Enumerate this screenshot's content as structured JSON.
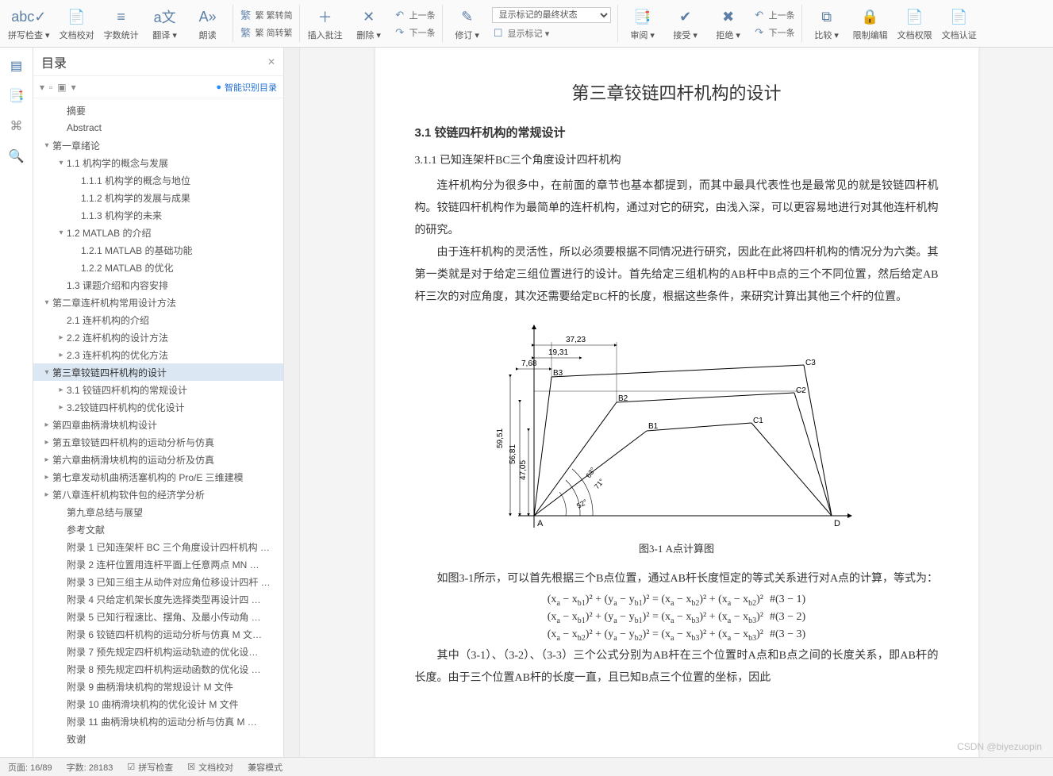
{
  "ribbon": {
    "big": [
      {
        "id": "spellcheck",
        "icon": "abc✓",
        "label": "拼写检查 ▾"
      },
      {
        "id": "docproof",
        "icon": "📄",
        "label": "文档校对"
      },
      {
        "id": "wordcount",
        "icon": "≡",
        "label": "字数统计"
      },
      {
        "id": "translate",
        "icon": "a文",
        "label": "翻译 ▾"
      },
      {
        "id": "readaloud",
        "icon": "A»",
        "label": "朗读"
      }
    ],
    "convert": {
      "top": "繁 繁转简",
      "bottom": "繁 简转繁",
      "icon": "繁"
    },
    "big2": [
      {
        "id": "insertcomment",
        "icon": "＋",
        "label": "插入批注"
      },
      {
        "id": "deletecomment",
        "icon": "✕",
        "label": "删除 ▾"
      }
    ],
    "nav": {
      "prev": "上一条",
      "next": "下一条",
      "prev_icon": "↶",
      "next_icon": "↷"
    },
    "big3": [
      {
        "id": "revise",
        "icon": "✎",
        "label": "修订 ▾"
      }
    ],
    "show": {
      "select_label": "显示标记的最终状态",
      "show_mark_label": "显示标记 ▾",
      "show_mark_icon": "☐"
    },
    "big4": [
      {
        "id": "reviewpane",
        "icon": "📑",
        "label": "审阅 ▾"
      },
      {
        "id": "accept",
        "icon": "✔",
        "label": "接受 ▾"
      },
      {
        "id": "reject",
        "icon": "✖",
        "label": "拒绝 ▾"
      }
    ],
    "nav2": {
      "prev": "上一条",
      "next": "下一条",
      "prev_icon": "↶",
      "next_icon": "↷"
    },
    "big5": [
      {
        "id": "compare",
        "icon": "⧉",
        "label": "比较 ▾"
      },
      {
        "id": "restrict",
        "icon": "🔒",
        "label": "限制编辑"
      },
      {
        "id": "docperm",
        "icon": "📄",
        "label": "文档权限"
      },
      {
        "id": "doccert",
        "icon": "📄",
        "label": "文档认证"
      }
    ]
  },
  "sidetabs": [
    {
      "id": "outline",
      "icon": "▤",
      "active": true
    },
    {
      "id": "nav",
      "icon": "📑",
      "active": false
    },
    {
      "id": "bookmark",
      "icon": "⌘",
      "active": false
    },
    {
      "id": "search",
      "icon": "🔍",
      "active": false
    }
  ],
  "outline": {
    "title": "目录",
    "close": "✕",
    "tools_left": [
      "▾",
      "▫",
      "▣",
      "▾"
    ],
    "smart_label": "智能识别目录",
    "smart_icon": "●",
    "items": [
      {
        "d": 1,
        "t": "",
        "lbl": "摘要"
      },
      {
        "d": 1,
        "t": "",
        "lbl": "Abstract"
      },
      {
        "d": 0,
        "t": "▾",
        "lbl": "第一章绪论"
      },
      {
        "d": 1,
        "t": "▾",
        "lbl": "1.1 机构学的概念与发展"
      },
      {
        "d": 2,
        "t": "",
        "lbl": "1.1.1 机构学的概念与地位"
      },
      {
        "d": 2,
        "t": "",
        "lbl": "1.1.2 机构学的发展与成果"
      },
      {
        "d": 2,
        "t": "",
        "lbl": "1.1.3 机构学的未来"
      },
      {
        "d": 1,
        "t": "▾",
        "lbl": "1.2 MATLAB 的介绍"
      },
      {
        "d": 2,
        "t": "",
        "lbl": "1.2.1 MATLAB 的基础功能"
      },
      {
        "d": 2,
        "t": "",
        "lbl": "1.2.2 MATLAB 的优化"
      },
      {
        "d": 1,
        "t": "",
        "lbl": "1.3 课题介绍和内容安排"
      },
      {
        "d": 0,
        "t": "▾",
        "lbl": "第二章连杆机构常用设计方法"
      },
      {
        "d": 1,
        "t": "",
        "lbl": "2.1 连杆机构的介绍"
      },
      {
        "d": 1,
        "t": "▸",
        "lbl": "2.2 连杆机构的设计方法"
      },
      {
        "d": 1,
        "t": "▸",
        "lbl": "2.3 连杆机构的优化方法"
      },
      {
        "d": 0,
        "t": "▾",
        "lbl": "第三章铰链四杆机构的设计",
        "sel": true
      },
      {
        "d": 1,
        "t": "▸",
        "lbl": "3.1 铰链四杆机构的常规设计"
      },
      {
        "d": 1,
        "t": "▸",
        "lbl": "3.2铰链四杆机构的优化设计"
      },
      {
        "d": 0,
        "t": "▸",
        "lbl": "第四章曲柄滑块机构设计"
      },
      {
        "d": 0,
        "t": "▸",
        "lbl": "第五章铰链四杆机构的运动分析与仿真"
      },
      {
        "d": 0,
        "t": "▸",
        "lbl": "第六章曲柄滑块机构的运动分析及仿真"
      },
      {
        "d": 0,
        "t": "▸",
        "lbl": "第七章发动机曲柄活塞机构的 Pro/E 三维建模"
      },
      {
        "d": 0,
        "t": "▸",
        "lbl": "第八章连杆机构软件包的经济学分析"
      },
      {
        "d": 1,
        "t": "",
        "lbl": "第九章总结与展望"
      },
      {
        "d": 1,
        "t": "",
        "lbl": "参考文献"
      },
      {
        "d": 1,
        "t": "",
        "lbl": "附录 1 已知连架杆 BC 三个角度设计四杆机构 …"
      },
      {
        "d": 1,
        "t": "",
        "lbl": "附录 2 连杆位置用连杆平面上任意两点 MN …"
      },
      {
        "d": 1,
        "t": "",
        "lbl": "附录 3 已知三组主从动件对应角位移设计四杆 …"
      },
      {
        "d": 1,
        "t": "",
        "lbl": "附录 4 只给定机架长度先选择类型再设计四 …"
      },
      {
        "d": 1,
        "t": "",
        "lbl": "附录 5 已知行程速比、摆角、及最小传动角 …"
      },
      {
        "d": 1,
        "t": "",
        "lbl": "附录 6 铰链四杆机构的运动分析与仿真 M 文…"
      },
      {
        "d": 1,
        "t": "",
        "lbl": "附录 7 预先规定四杆机构运动轨迹的优化设…"
      },
      {
        "d": 1,
        "t": "",
        "lbl": "附录 8 预先规定四杆机构运动函数的优化设 …"
      },
      {
        "d": 1,
        "t": "",
        "lbl": "附录 9 曲柄滑块机构的常规设计 M 文件"
      },
      {
        "d": 1,
        "t": "",
        "lbl": "附录 10 曲柄滑块机构的优化设计 M 文件"
      },
      {
        "d": 1,
        "t": "",
        "lbl": "附录 11 曲柄滑块机构的运动分析与仿真 M …"
      },
      {
        "d": 1,
        "t": "",
        "lbl": "致谢"
      }
    ]
  },
  "doc": {
    "h1": "第三章铰链四杆机构的设计",
    "h2": "3.1  铰链四杆机构的常规设计",
    "h3": "3.1.1  已知连架杆BC三个角度设计四杆机构",
    "p1": "连杆机构分为很多中，在前面的章节也基本都提到，而其中最具代表性也是最常见的就是铰链四杆机构。铰链四杆机构作为最简单的连杆机构，通过对它的研究，由浅入深，可以更容易地进行对其他连杆机构的研究。",
    "p2": "由于连杆机构的灵活性，所以必须要根据不同情况进行研究，因此在此将四杆机构的情况分为六类。其第一类就是对于给定三组位置进行的设计。首先给定三组机构的AB杆中B点的三个不同位置，然后给定AB杆三次的对应角度，其次还需要给定BC杆的长度，根据这些条件，来研究计算出其他三个杆的位置。",
    "figcap": "图3-1 A点计算图",
    "p3": "如图3-1所示，可以首先根据三个B点位置，通过AB杆长度恒定的等式关系进行对A点的计算，等式为：",
    "eq1": "(xₐ − x_b1)² + (yₐ − y_b1)² = (xₐ − x_b2)² + (xₐ − x_b2)²#(3 − 1)",
    "eq2": "(xₐ − x_b1)² + (yₐ − y_b1)² = (xₐ − x_b3)² + (xₐ − x_b3)²#(3 − 2)",
    "eq3": "(xₐ − x_b2)² + (yₐ − y_b2)² = (xₐ − x_b3)² + (xₐ − x_b3)²#(3 − 3)",
    "p4": "其中（3-1）、（3-2）、（3-3）三个公式分别为AB杆在三个位置时A点和B点之间的长度关系，即AB杆的长度。由于三个位置AB杆的长度一直，且已知B点三个位置的坐标，因此",
    "fig": {
      "dims": {
        "d1": "37,23",
        "d2": "19,31",
        "d3": "7,68",
        "v1": "59,51",
        "v2": "56,81",
        "v3": "47,05"
      },
      "pts": {
        "A": "A",
        "D": "D",
        "B1": "B1",
        "B2": "B2",
        "B3": "B3",
        "C1": "C1",
        "C2": "C2",
        "C3": "C3"
      },
      "ang": {
        "a1": "63°",
        "a2": "71°",
        "a3": "52°"
      }
    }
  },
  "status": {
    "page": "页面: 16/89",
    "words": "字数: 28183",
    "spell": "拼写检查",
    "proof": "文档校对",
    "compat": "兼容模式"
  },
  "watermark": "CSDN @biyezuopin"
}
